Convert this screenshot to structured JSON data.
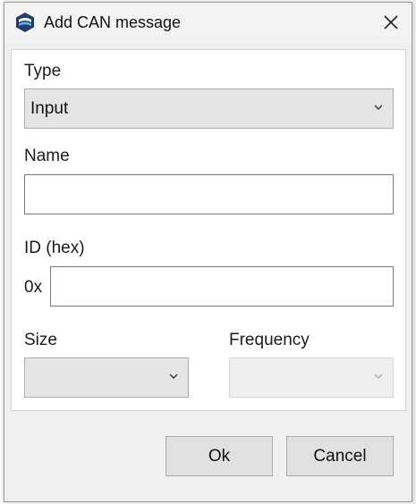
{
  "dialog": {
    "title": "Add CAN message",
    "close_label": "close"
  },
  "form": {
    "type": {
      "label": "Type",
      "selected": "Input"
    },
    "name": {
      "label": "Name",
      "value": ""
    },
    "id": {
      "label": "ID (hex)",
      "prefix": "0x",
      "value": ""
    },
    "size": {
      "label": "Size",
      "selected": ""
    },
    "frequency": {
      "label": "Frequency",
      "selected": ""
    }
  },
  "buttons": {
    "ok_label": "Ok",
    "cancel_label": "Cancel"
  },
  "colors": {
    "window_bg": "#f0f0f0",
    "combo_bg": "#e5e5e5",
    "button_bg": "#e1e1e1",
    "icon_blue": "#1e63a8"
  },
  "icons": [
    "app-logo-icon",
    "close-icon",
    "chevron-down-icon"
  ]
}
